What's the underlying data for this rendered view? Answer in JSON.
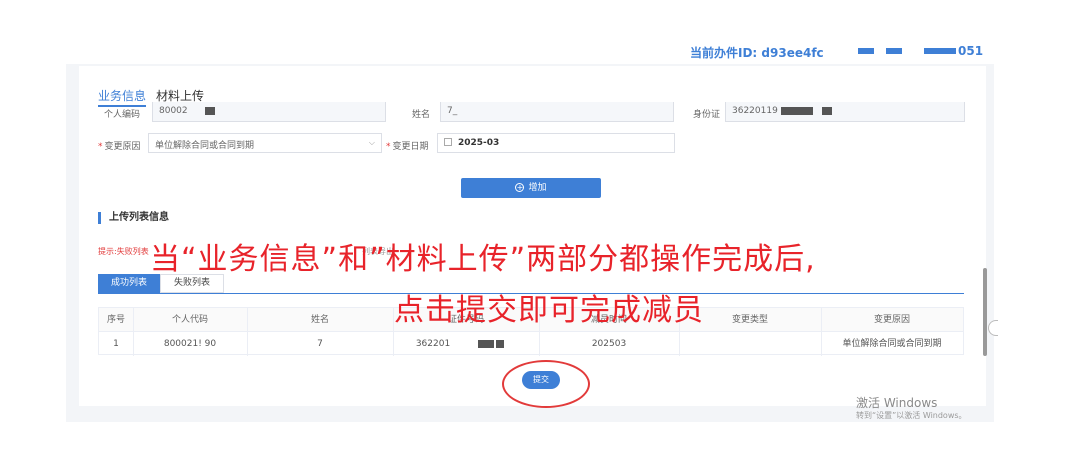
{
  "header": {
    "current_id": "当前办件ID: d93ee4fc",
    "tail": "051"
  },
  "tabs": {
    "business_info": "业务信息",
    "material_upload": "材料上传"
  },
  "form": {
    "personal_code_label": "个人编码",
    "personal_code_value": "80002",
    "name_label": "姓名",
    "name_value": "7_",
    "id_label": "身份证",
    "id_value": "36220119",
    "change_reason_label": "变更原因",
    "change_reason_value": "单位解除合同或合同到期",
    "change_date_label": "变更日期",
    "change_date_value": "2025-03",
    "required_mark": "*"
  },
  "add_button": {
    "label": "增加",
    "icon": "plus-circle-icon"
  },
  "upload_section": {
    "title": "上传列表信息",
    "hint_left": "提示:失败列表",
    "hint_right": "列表导出"
  },
  "subtabs": {
    "success": "成功列表",
    "failed": "失败列表"
  },
  "table": {
    "headers": [
      "序号",
      "个人代码",
      "姓名",
      "证件号码",
      "减员时间",
      "变更类型",
      "变更原因"
    ],
    "rows": [
      [
        "1",
        "800021!      90",
        "7",
        "362201",
        "202503",
        "",
        "单位解除合同或合同到期"
      ]
    ]
  },
  "submit_button": {
    "label": "提交"
  },
  "annotation": {
    "line1": "当“业务信息”和”材料上传”两部分都操作完成后,",
    "line2": "点击提交即可完成减员"
  },
  "watermark": {
    "line1": "激活 Windows",
    "line2": "转到“设置”以激活 Windows。"
  },
  "colors": {
    "accent": "#3e7fd6",
    "annotation": "#e8232a"
  }
}
